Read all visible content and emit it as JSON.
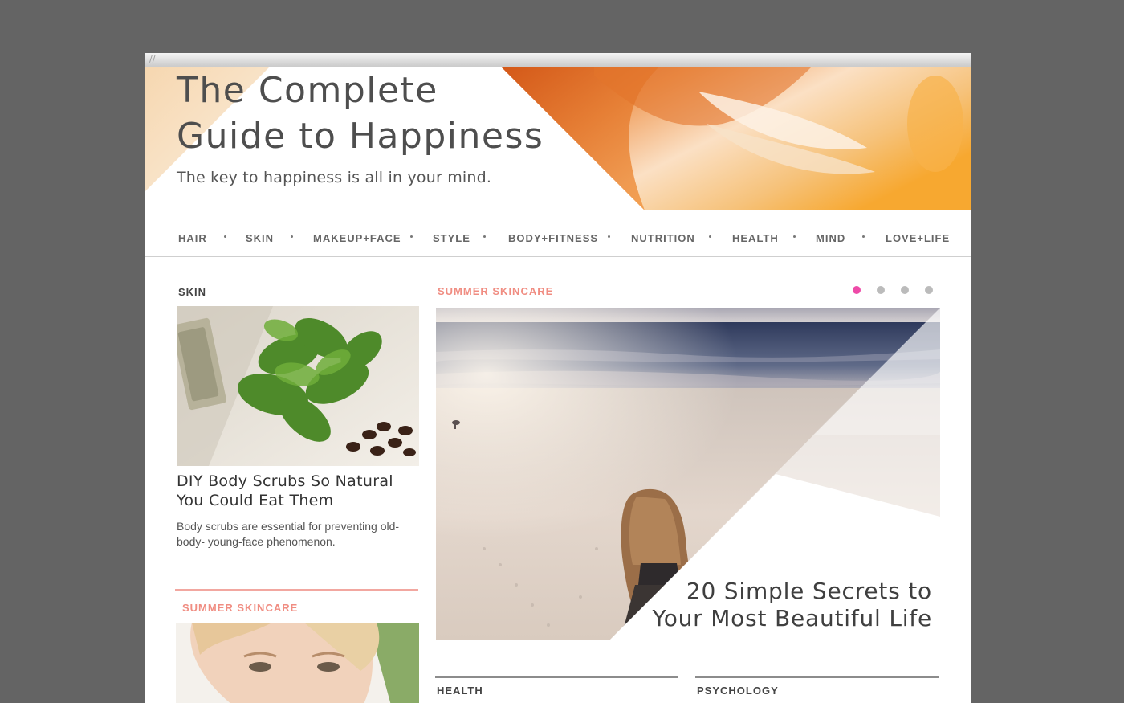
{
  "window": {
    "grip": "//"
  },
  "header": {
    "title_line1": "The Complete",
    "title_line2": "Guide to Happiness",
    "subtitle": "The key to happiness is all in your mind."
  },
  "nav": {
    "items": [
      "HAIR",
      "SKIN",
      "MAKEUP+FACE",
      "STYLE",
      "BODY+FITNESS",
      "NUTRITION",
      "HEALTH",
      "MIND",
      "LOVE+LIFE"
    ]
  },
  "left_column": {
    "section_label": "SKIN",
    "article": {
      "title": "DIY Body Scrubs So Natural You Could Eat Them",
      "description": "Body scrubs are essential for preventing old-body- young-face phenomenon."
    },
    "second_section_label": "SUMMER SKINCARE"
  },
  "feature": {
    "section_label": "SUMMER SKINCARE",
    "title_line1": "20 Simple Secrets to",
    "title_line2": "Your Most Beautiful Life",
    "carousel": {
      "count": 4,
      "active_index": 0
    }
  },
  "bottom_sections": [
    "HEALTH",
    "PSYCHOLOGY"
  ],
  "colors": {
    "page_bg": "#646464",
    "accent_pink": "#f08d82",
    "carousel_active": "#ee4aa8",
    "carousel_inactive": "#bbbbbb",
    "text_dark": "#4e4e4e"
  }
}
